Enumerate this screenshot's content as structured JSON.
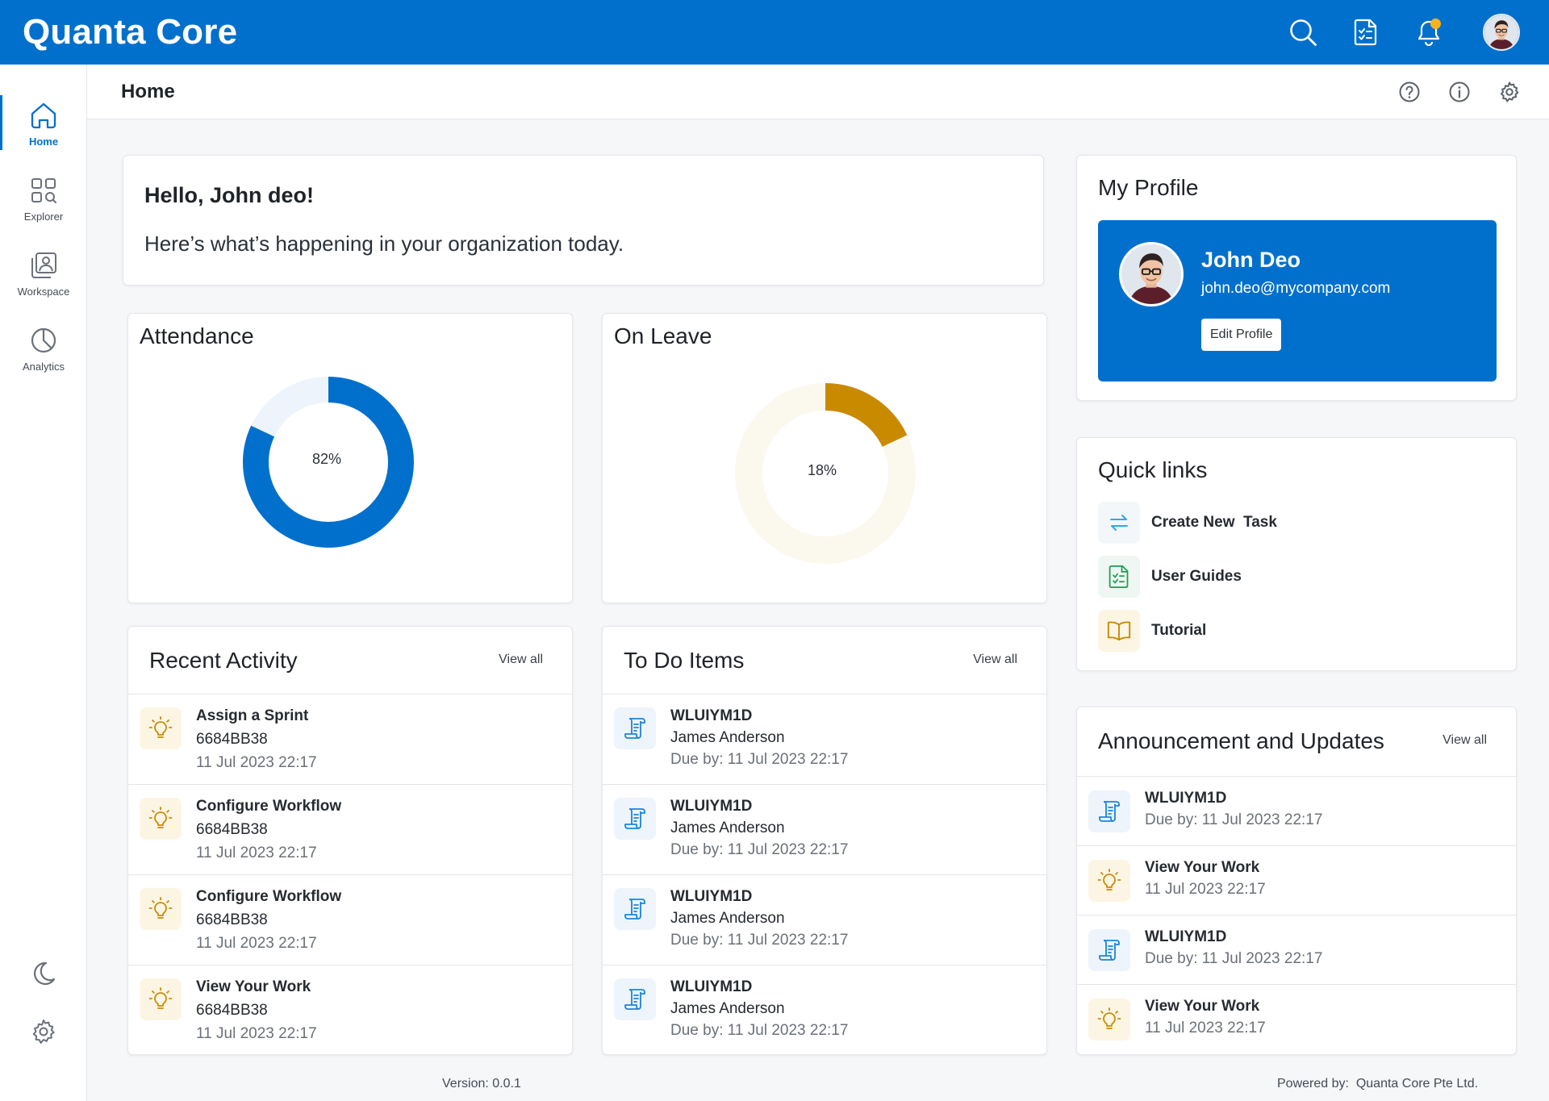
{
  "app": {
    "brand": "Quanta Core"
  },
  "colors": {
    "primary": "#0070cc",
    "attendance": "#0070cc",
    "leave": "#c98a00",
    "notification": "#f5b120"
  },
  "topbar": {
    "icons": [
      "search-icon",
      "tasks-icon",
      "bell-icon",
      "avatar"
    ]
  },
  "sidebar": {
    "items": [
      {
        "label": "Home",
        "icon": "home-icon",
        "active": true
      },
      {
        "label": "Explorer",
        "icon": "explorer-icon",
        "active": false
      },
      {
        "label": "Workspace",
        "icon": "workspace-icon",
        "active": false
      },
      {
        "label": "Analytics",
        "icon": "analytics-icon",
        "active": false
      }
    ],
    "bottom_icons": [
      "moon-icon",
      "gear-icon"
    ]
  },
  "header": {
    "title": "Home",
    "icons": [
      "help-icon",
      "info-icon",
      "settings-icon"
    ]
  },
  "welcome": {
    "greeting": "Hello, John deo!",
    "subtitle": "Here’s what’s happening in your organization today."
  },
  "attendance": {
    "title": "Attendance",
    "percent": 82,
    "label": "82%"
  },
  "leave": {
    "title": "On Leave",
    "percent": 18,
    "label": "18%"
  },
  "recent_activity": {
    "title": "Recent Activity",
    "view_all": "View all",
    "items": [
      {
        "title": "Assign a Sprint",
        "code": "6684BB38",
        "time": "11 Jul 2023 22:17"
      },
      {
        "title": "Configure Workflow",
        "code": "6684BB38",
        "time": "11 Jul 2023 22:17"
      },
      {
        "title": "Configure Workflow",
        "code": "6684BB38",
        "time": "11 Jul 2023 22:17"
      },
      {
        "title": "View Your Work",
        "code": "6684BB38",
        "time": "11 Jul 2023 22:17"
      }
    ]
  },
  "todo": {
    "title": "To Do Items",
    "view_all": "View all",
    "items": [
      {
        "title": "WLUIYM1D",
        "person": "James Anderson",
        "due": "Due by: 11 Jul 2023 22:17"
      },
      {
        "title": "WLUIYM1D",
        "person": "James Anderson",
        "due": "Due by: 11 Jul 2023 22:17"
      },
      {
        "title": "WLUIYM1D",
        "person": "James Anderson",
        "due": "Due by: 11 Jul 2023 22:17"
      },
      {
        "title": "WLUIYM1D",
        "person": "James Anderson",
        "due": "Due by: 11 Jul 2023 22:17"
      }
    ]
  },
  "profile": {
    "title": "My Profile",
    "name": "John Deo",
    "email": "john.deo@mycompany.com",
    "edit_label": "Edit Profile"
  },
  "quick_links": {
    "title": "Quick links",
    "items": [
      {
        "label": "Create New  Task",
        "icon": "swap-arrows-icon"
      },
      {
        "label": "User Guides",
        "icon": "checklist-doc-icon"
      },
      {
        "label": "Tutorial",
        "icon": "book-icon"
      }
    ]
  },
  "announcements": {
    "title": "Announcement and Updates",
    "view_all": "View all",
    "items": [
      {
        "title": "WLUIYM1D",
        "sub": "Due by: 11 Jul 2023 22:17",
        "icon": "scroll-icon"
      },
      {
        "title": "View Your Work",
        "sub": "11 Jul 2023 22:17",
        "icon": "bulb-icon"
      },
      {
        "title": "WLUIYM1D",
        "sub": "Due by: 11 Jul 2023 22:17",
        "icon": "scroll-icon"
      },
      {
        "title": "View Your Work",
        "sub": "11 Jul 2023 22:17",
        "icon": "bulb-icon"
      }
    ]
  },
  "footer": {
    "version": "Version: 0.0.1",
    "powered": "Powered by:  Quanta Core Pte Ltd."
  }
}
